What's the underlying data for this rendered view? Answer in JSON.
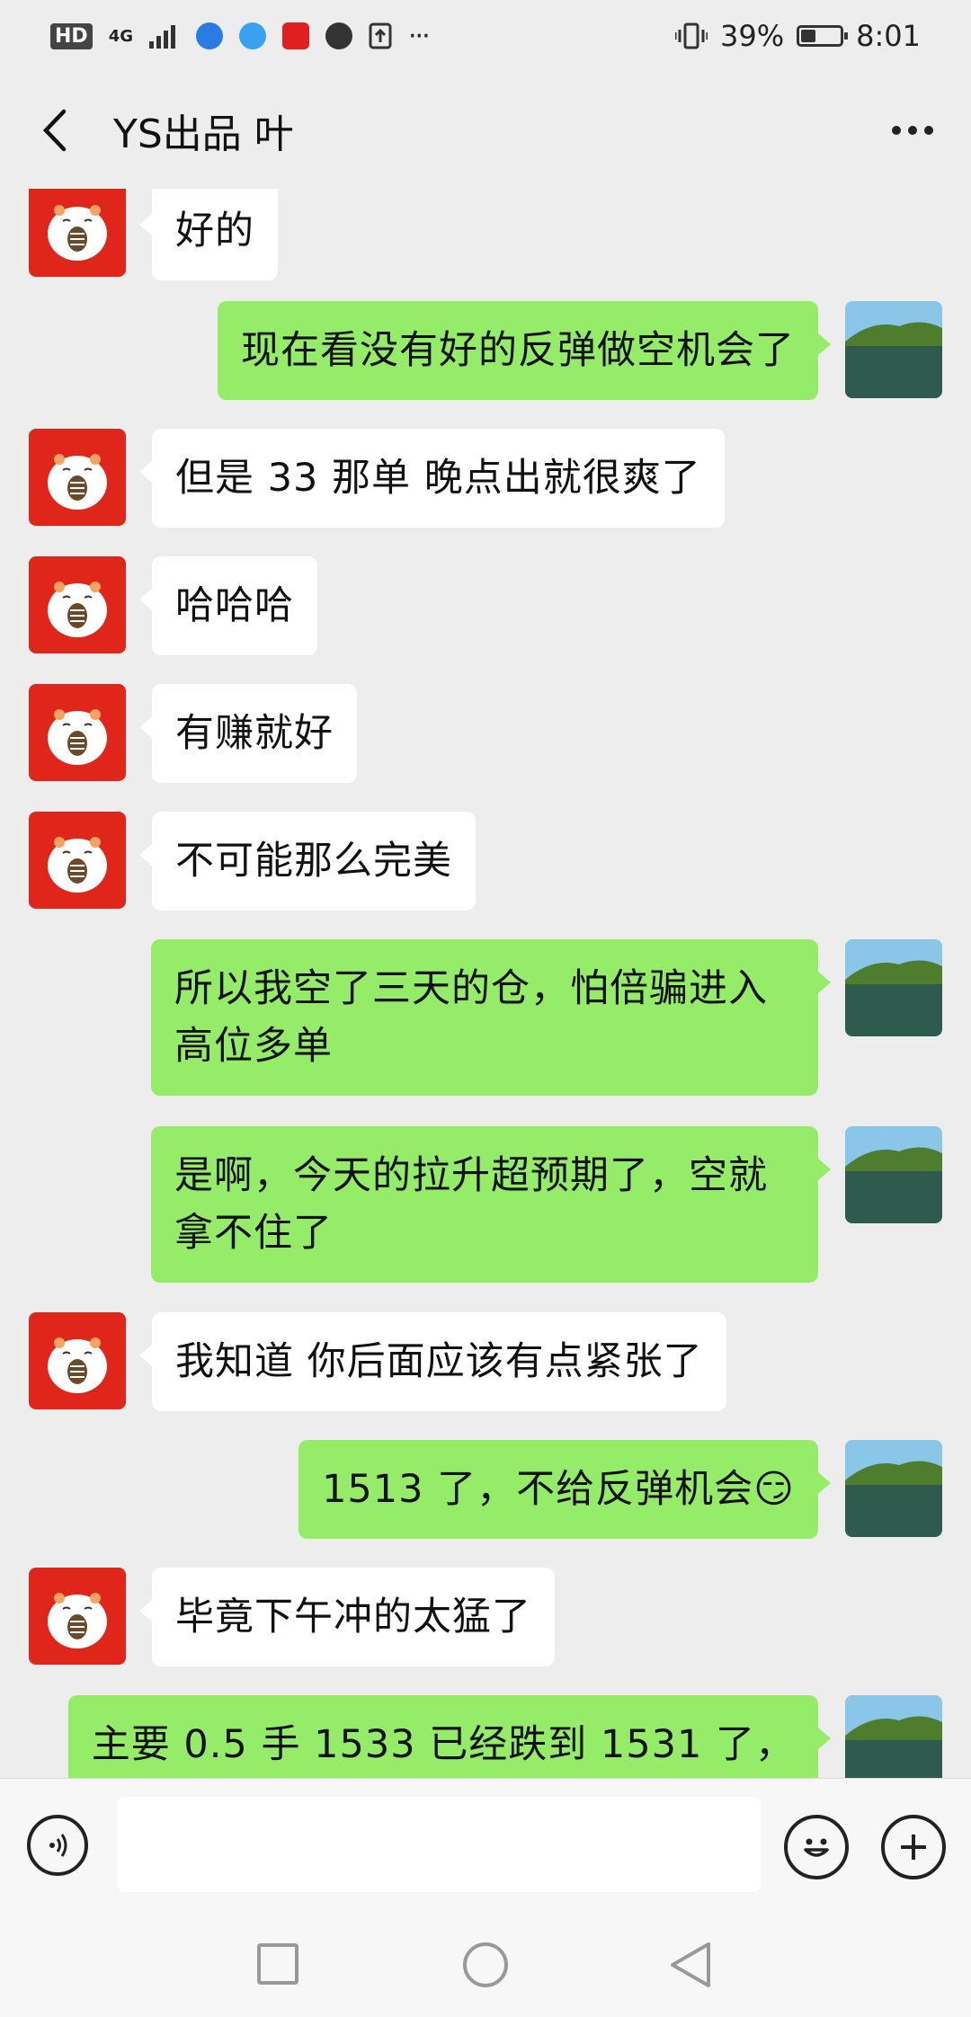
{
  "status_bar": {
    "left_labels": [
      "HD",
      "4G"
    ],
    "battery_percent_text": "39%",
    "battery_level": 0.39,
    "time": "8:01",
    "more_indicator": "···"
  },
  "header": {
    "title": "YS出品 叶"
  },
  "messages": [
    {
      "side": "left",
      "text": "好的"
    },
    {
      "side": "right",
      "text": "现在看没有好的反弹做空机会了"
    },
    {
      "side": "left",
      "text": "但是 33 那单 晚点出就很爽了"
    },
    {
      "side": "left",
      "text": "哈哈哈"
    },
    {
      "side": "left",
      "text": "有赚就好"
    },
    {
      "side": "left",
      "text": "不可能那么完美"
    },
    {
      "side": "right",
      "text": "所以我空了三天的仓，怕倍骗进入高位多单"
    },
    {
      "side": "right",
      "text": "是啊，今天的拉升超预期了，空就拿不住了"
    },
    {
      "side": "left",
      "text": "我知道 你后面应该有点紧张了"
    },
    {
      "side": "right",
      "text": "1513 了，不给反弹机会😏"
    },
    {
      "side": "left",
      "text": "毕竟下午冲的太猛了"
    },
    {
      "side": "right",
      "text": "主要 0.5 手 1533 已经跌到 1531 了，"
    }
  ],
  "colors": {
    "sent_bubble": "#95ec69",
    "received_bubble": "#ffffff",
    "chat_background": "#ededed",
    "contact_avatar": "#e0251b"
  }
}
